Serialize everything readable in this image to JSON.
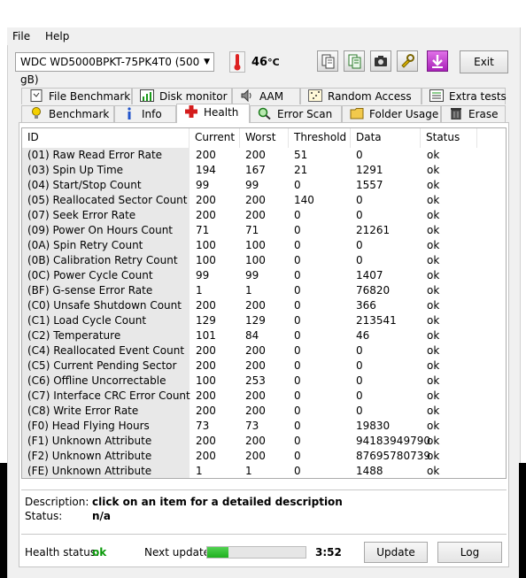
{
  "menu": {
    "file": "File",
    "help": "Help"
  },
  "toolbar": {
    "drive": "WDC WD5000BPKT-75PK4T0 (500 gB)",
    "temperature": "46",
    "temperature_unit": "°C",
    "exit_label": "Exit"
  },
  "tabs": {
    "top": [
      "File Benchmark",
      "Disk monitor",
      "AAM",
      "Random Access",
      "Extra tests"
    ],
    "bottom": [
      "Benchmark",
      "Info",
      "Health",
      "Error Scan",
      "Folder Usage",
      "Erase"
    ],
    "active": "Health"
  },
  "table": {
    "headers": [
      "ID",
      "Current",
      "Worst",
      "Threshold",
      "Data",
      "Status"
    ],
    "rows": [
      [
        "(01) Raw Read Error Rate",
        "200",
        "200",
        "51",
        "0",
        "ok"
      ],
      [
        "(03) Spin Up Time",
        "194",
        "167",
        "21",
        "1291",
        "ok"
      ],
      [
        "(04) Start/Stop Count",
        "99",
        "99",
        "0",
        "1557",
        "ok"
      ],
      [
        "(05) Reallocated Sector Count",
        "200",
        "200",
        "140",
        "0",
        "ok"
      ],
      [
        "(07) Seek Error Rate",
        "200",
        "200",
        "0",
        "0",
        "ok"
      ],
      [
        "(09) Power On Hours Count",
        "71",
        "71",
        "0",
        "21261",
        "ok"
      ],
      [
        "(0A) Spin Retry Count",
        "100",
        "100",
        "0",
        "0",
        "ok"
      ],
      [
        "(0B) Calibration Retry Count",
        "100",
        "100",
        "0",
        "0",
        "ok"
      ],
      [
        "(0C) Power Cycle Count",
        "99",
        "99",
        "0",
        "1407",
        "ok"
      ],
      [
        "(BF) G-sense Error Rate",
        "1",
        "1",
        "0",
        "76820",
        "ok"
      ],
      [
        "(C0) Unsafe Shutdown Count",
        "200",
        "200",
        "0",
        "366",
        "ok"
      ],
      [
        "(C1) Load Cycle Count",
        "129",
        "129",
        "0",
        "213541",
        "ok"
      ],
      [
        "(C2) Temperature",
        "101",
        "84",
        "0",
        "46",
        "ok"
      ],
      [
        "(C4) Reallocated Event Count",
        "200",
        "200",
        "0",
        "0",
        "ok"
      ],
      [
        "(C5) Current Pending Sector",
        "200",
        "200",
        "0",
        "0",
        "ok"
      ],
      [
        "(C6) Offline Uncorrectable",
        "100",
        "253",
        "0",
        "0",
        "ok"
      ],
      [
        "(C7) Interface CRC Error Count",
        "200",
        "200",
        "0",
        "0",
        "ok"
      ],
      [
        "(C8) Write Error Rate",
        "200",
        "200",
        "0",
        "0",
        "ok"
      ],
      [
        "(F0) Head Flying Hours",
        "73",
        "73",
        "0",
        "19830",
        "ok"
      ],
      [
        "(F1) Unknown Attribute",
        "200",
        "200",
        "0",
        "94183949790",
        "ok"
      ],
      [
        "(F2) Unknown Attribute",
        "200",
        "200",
        "0",
        "87695780739",
        "ok"
      ],
      [
        "(FE) Unknown Attribute",
        "1",
        "1",
        "0",
        "1488",
        "ok"
      ]
    ]
  },
  "details": {
    "description_label": "Description:",
    "description_value": "click on an item for a detailed description",
    "status_label": "Status:",
    "status_value": "n/a"
  },
  "footer": {
    "health_label": "Health status:",
    "health_value": "ok",
    "next_update_label": "Next update:",
    "next_update_progress": 0.22,
    "next_update_time": "3:52",
    "update_button": "Update",
    "log_button": "Log"
  },
  "colors": {
    "ok_green": "#0a9a0a",
    "progress_green": "#2fbf2f",
    "id_column_bg": "#e8e8e8"
  }
}
